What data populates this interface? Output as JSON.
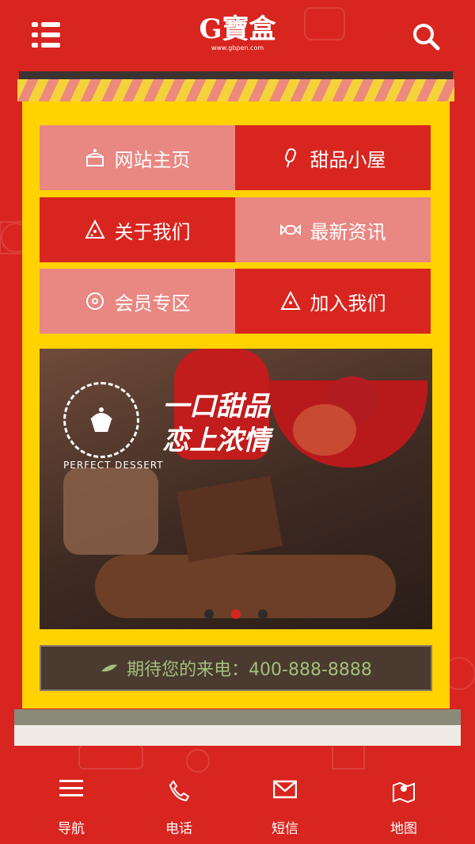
{
  "header": {
    "logo_main": "G寶盒",
    "logo_sub": "www.gbpen.com",
    "menu_icon": "menu-icon",
    "search_icon": "search-icon"
  },
  "nav_tiles": [
    {
      "label": "网站主页",
      "icon": "cake-icon"
    },
    {
      "label": "甜品小屋",
      "icon": "popsicle-icon"
    },
    {
      "label": "关于我们",
      "icon": "pizza-slice-icon"
    },
    {
      "label": "最新资讯",
      "icon": "candy-icon"
    },
    {
      "label": "会员专区",
      "icon": "donut-icon"
    },
    {
      "label": "加入我们",
      "icon": "pizza-slice-icon"
    }
  ],
  "banner": {
    "slogan_line1": "一口甜品",
    "slogan_line2": "恋上浓情",
    "badge_text": "PERFECT DESSERT",
    "slides": 3,
    "active_slide": 2
  },
  "contact": {
    "text": "期待您的来电：400-888-8888",
    "icon": "pea-pod-icon"
  },
  "footer": [
    {
      "label": "导航",
      "icon": "menu-icon"
    },
    {
      "label": "电话",
      "icon": "phone-icon"
    },
    {
      "label": "短信",
      "icon": "envelope-icon"
    },
    {
      "label": "地图",
      "icon": "map-icon"
    }
  ],
  "colors": {
    "brand_red": "#d9251f",
    "tile_light": "#e98782",
    "store_yellow": "#ffd200",
    "contact_bg": "#4a3a30",
    "contact_text": "#a3c07a"
  }
}
